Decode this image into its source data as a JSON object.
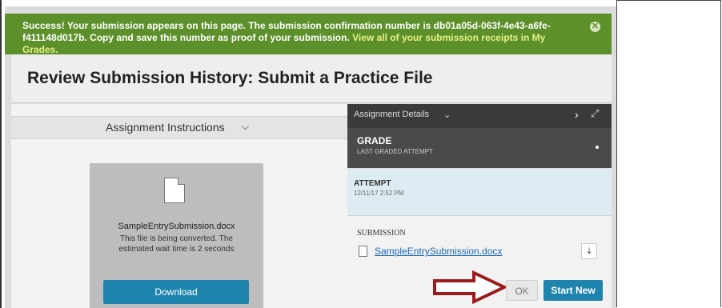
{
  "success": {
    "message": "Success! Your submission appears on this page. The submission confirmation number is db01a05d-063f-4e43-a6fe-f411148d017b. Copy and save this number as proof of your submission.",
    "link": "View all of your submission receipts in My Grades."
  },
  "page_title": "Review Submission History: Submit a Practice File",
  "instructions": {
    "label": "Assignment Instructions"
  },
  "preview": {
    "filename": "SampleEntrySubmission.docx",
    "message": "This file is being converted. The estimated wait time is 2 seconds",
    "download_label": "Download"
  },
  "details": {
    "header": "Assignment Details",
    "grade_title": "GRADE",
    "grade_subtitle": "LAST GRADED ATTEMPT",
    "attempt_title": "ATTEMPT",
    "attempt_date": "12/11/17 2:52 PM",
    "submission_title": "SUBMISSION",
    "submission_file": "SampleEntrySubmission.docx"
  },
  "buttons": {
    "ok": "OK",
    "start_new": "Start New"
  },
  "colors": {
    "success_bg": "#5d8f2a",
    "primary_button": "#1f84ad",
    "arrow": "#9b1c1c"
  },
  "icons": [
    "close-icon",
    "chevron-down-icon",
    "chevron-right-icon",
    "expand-icon",
    "document-icon",
    "download-icon",
    "arrow-icon"
  ]
}
